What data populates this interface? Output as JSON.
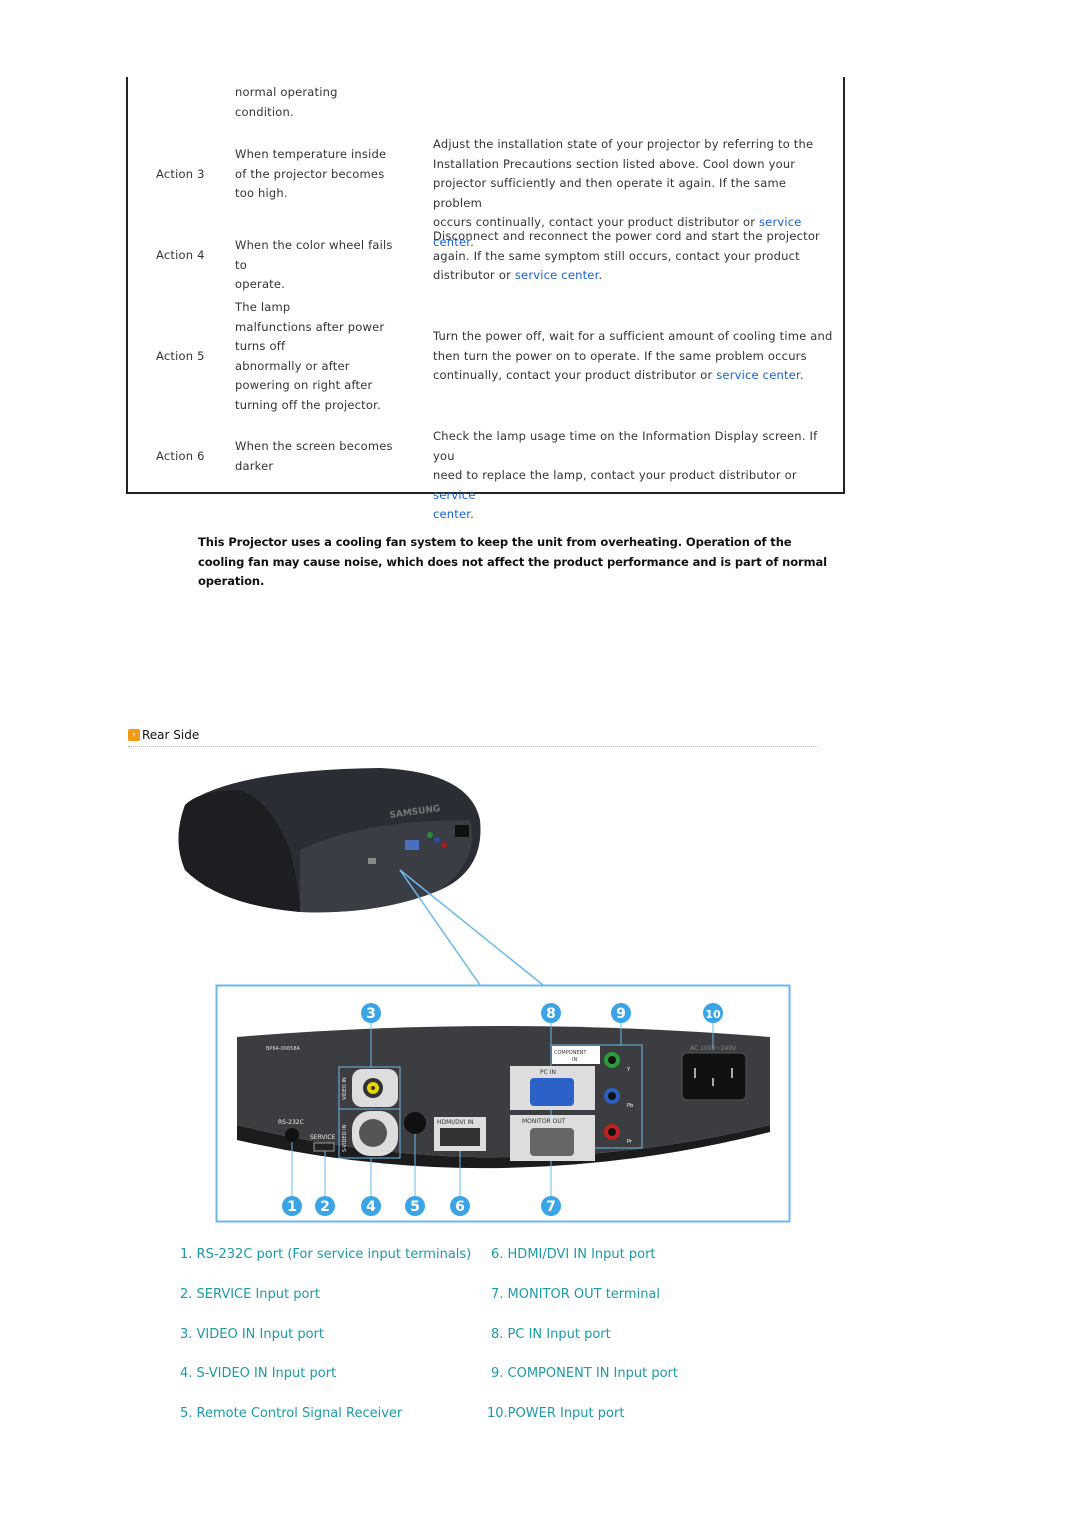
{
  "table": {
    "rows": [
      {
        "action": "",
        "condition": [
          "normal operating",
          "condition."
        ],
        "solution": []
      },
      {
        "action": "Action 3",
        "condition": [
          "When temperature inside",
          "of the projector becomes",
          "too high."
        ],
        "solution": [
          "Adjust the installation state of your projector by referring to the",
          "Installation Precautions section listed above. Cool down your",
          "projector sufficiently and then operate it again. If the same problem",
          "occurs continually, contact your product distributor or "
        ],
        "link": "service center",
        "tail": "."
      },
      {
        "action": "Action 4",
        "condition": [
          "When the color wheel fails to",
          "operate."
        ],
        "solution": [
          "Disconnect and reconnect the power cord and start the projector",
          "again. If the same symptom still occurs, contact your product",
          "distributor or "
        ],
        "link": "service center",
        "tail": "."
      },
      {
        "action": "Action 5",
        "condition": [
          "The lamp",
          "malfunctions after power",
          "turns off",
          "abnormally or after",
          "powering on right after",
          "turning off the projector."
        ],
        "solution": [
          "Turn the power off, wait for a sufficient amount of cooling time and",
          "then turn the power on to operate. If the same problem occurs",
          "continually, contact your product distributor or "
        ],
        "link": "service center",
        "tail": "."
      },
      {
        "action": "Action 6",
        "condition": [
          "When the screen becomes",
          "darker"
        ],
        "solution": [
          "Check the lamp usage time on the Information Display screen. If you",
          "need to replace the lamp, contact your product distributor or "
        ],
        "link": "service",
        "link2": "center",
        "tail": "."
      }
    ]
  },
  "note": "This Projector uses a cooling fan system to keep the unit from overheating. Operation of the cooling fan may cause noise, which does not affect the product performance and is part of normal operation.",
  "section": {
    "title": "Rear Side",
    "icon": "orange-arrow-bullet-icon"
  },
  "figure": {
    "brand_logo": "SAMSUNG",
    "model_label": "BP64-00658A",
    "labels": {
      "rs232c": "RS-232C",
      "service": "SERVICE",
      "video_in": "VIDEO IN",
      "svideo_in": "S-VIDEO IN",
      "hdmi": "HDMI/DVI IN",
      "pc_in": "PC IN",
      "monitor_out": "MONITOR OUT",
      "component": "COMPONENT",
      "component2": "IN",
      "ac": "AC 100V~240V",
      "y": "Y",
      "pb": "Pb",
      "pr": "Pr"
    },
    "callouts": [
      "1",
      "2",
      "3",
      "4",
      "5",
      "6",
      "7",
      "8",
      "9",
      "10"
    ],
    "colors": {
      "frame": "#6cb8e8",
      "callout": "#3aa4e6"
    }
  },
  "ports": [
    "1. RS-232C port (For service input terminals)",
    "2. SERVICE Input port",
    "3. VIDEO IN Input port",
    "4. S-VIDEO IN Input port",
    "5. Remote Control Signal Receiver",
    "6. HDMI/DVI IN Input port",
    "7. MONITOR OUT terminal",
    "8. PC IN Input port",
    "9. COMPONENT IN Input port",
    "10.POWER Input port"
  ],
  "colors": {
    "link": "#1560d6",
    "list": "#1b9aa8",
    "bullet": "#f39a12",
    "divider": "#9ed36a"
  }
}
